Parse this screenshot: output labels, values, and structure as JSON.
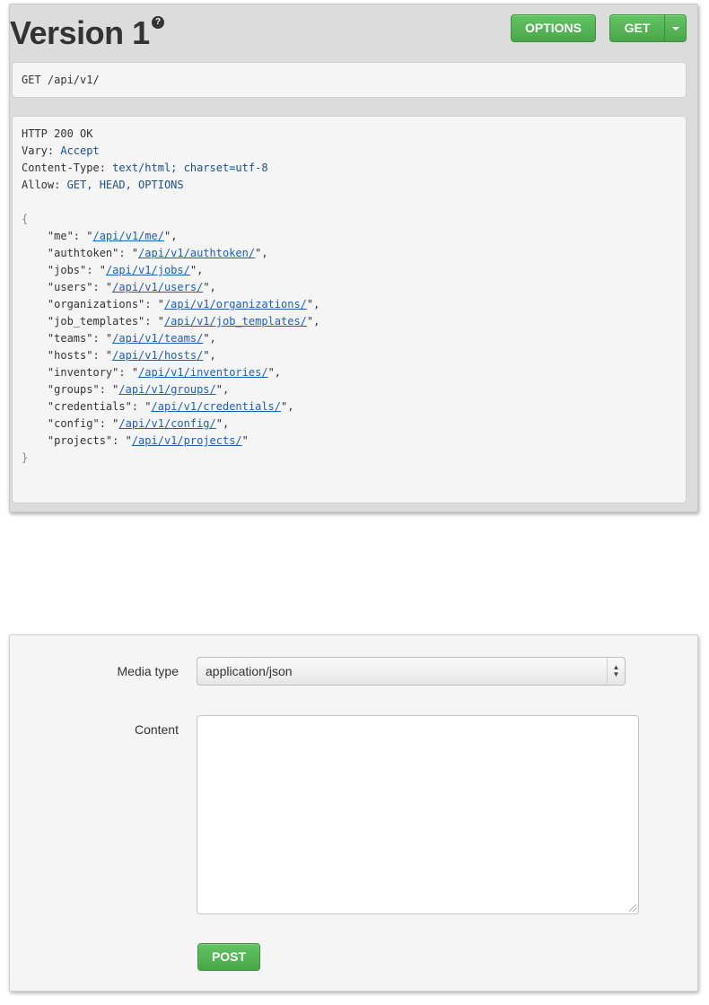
{
  "header": {
    "title": "Version 1",
    "help_icon_glyph": "?",
    "options_label": "OPTIONS",
    "get_label": "GET"
  },
  "request": {
    "text": "GET /api/v1/"
  },
  "response": {
    "status_line": "HTTP 200 OK",
    "headers": [
      {
        "name": "Vary",
        "value": "Accept"
      },
      {
        "name": "Content-Type",
        "value": "text/html; charset=utf-8"
      },
      {
        "name": "Allow",
        "value": "GET, HEAD, OPTIONS"
      }
    ],
    "open_brace": "{",
    "close_brace": "}",
    "entries": [
      {
        "key": "me",
        "url": "/api/v1/me/"
      },
      {
        "key": "authtoken",
        "url": "/api/v1/authtoken/"
      },
      {
        "key": "jobs",
        "url": "/api/v1/jobs/"
      },
      {
        "key": "users",
        "url": "/api/v1/users/"
      },
      {
        "key": "organizations",
        "url": "/api/v1/organizations/"
      },
      {
        "key": "job_templates",
        "url": "/api/v1/job_templates/"
      },
      {
        "key": "teams",
        "url": "/api/v1/teams/"
      },
      {
        "key": "hosts",
        "url": "/api/v1/hosts/"
      },
      {
        "key": "inventory",
        "url": "/api/v1/inventories/"
      },
      {
        "key": "groups",
        "url": "/api/v1/groups/"
      },
      {
        "key": "credentials",
        "url": "/api/v1/credentials/"
      },
      {
        "key": "config",
        "url": "/api/v1/config/"
      },
      {
        "key": "projects",
        "url": "/api/v1/projects/"
      }
    ]
  },
  "form": {
    "media_type_label": "Media type",
    "media_type_value": "application/json",
    "content_label": "Content",
    "content_value": "",
    "post_label": "POST"
  },
  "colors": {
    "button_green": "#5bb75b",
    "link_blue": "#1e5fb8",
    "panel_gray": "#dcdcdc"
  }
}
